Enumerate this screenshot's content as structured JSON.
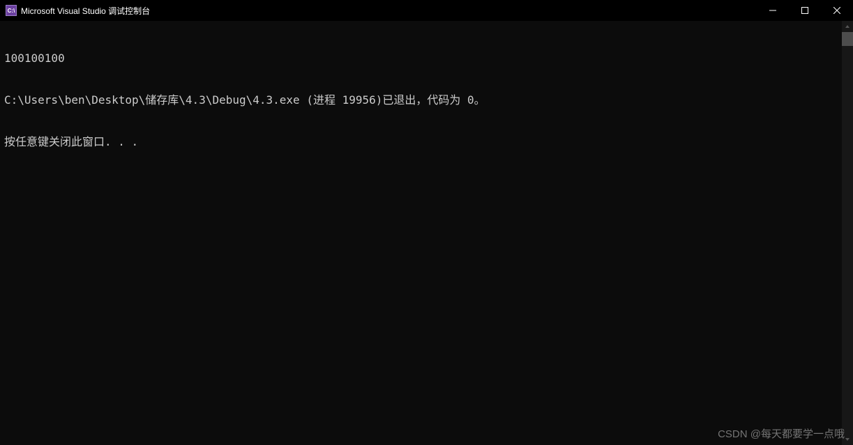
{
  "titlebar": {
    "icon_label": "C:\\",
    "title": "Microsoft Visual Studio 调试控制台"
  },
  "window_controls": {
    "minimize": "minimize",
    "maximize": "maximize",
    "close": "close"
  },
  "console": {
    "lines": {
      "l0": "100100100",
      "l1": "C:\\Users\\ben\\Desktop\\储存库\\4.3\\Debug\\4.3.exe (进程 19956)已退出，代码为 0。",
      "l2": "按任意键关闭此窗口. . ."
    }
  },
  "watermark": "CSDN @每天都要学一点哦"
}
